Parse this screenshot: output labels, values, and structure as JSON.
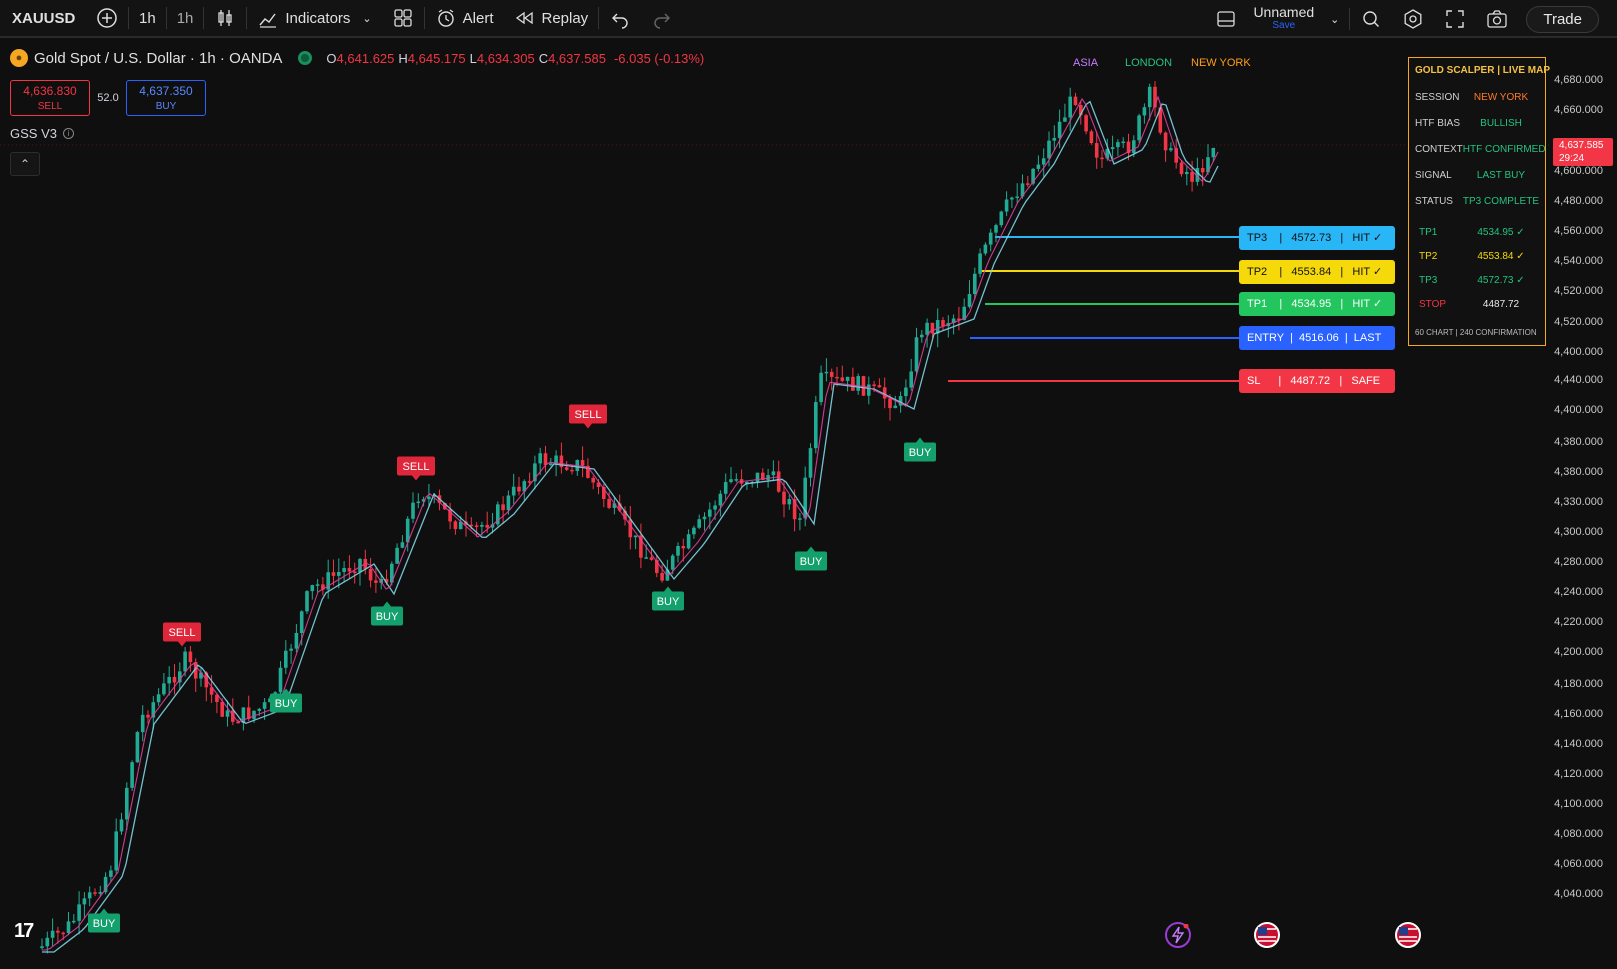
{
  "toolbar": {
    "symbol": "XAUUSD",
    "interval_1": "1h",
    "interval_2": "1h",
    "indicators_label": "Indicators",
    "alert_label": "Alert",
    "replay_label": "Replay",
    "layout_name": "Unnamed",
    "save_label": "Save",
    "trade_label": "Trade"
  },
  "header": {
    "title": "Gold Spot / U.S. Dollar · 1h · OANDA",
    "open_label": "O",
    "open": "4,641.625",
    "high_label": "H",
    "high": "4,645.175",
    "low_label": "L",
    "low": "4,634.305",
    "close_label": "C",
    "close": "4,637.585",
    "change": "-6.035 (-0.13%)",
    "sell_price": "4,636.830",
    "sell_label": "SELL",
    "spread": "52.0",
    "buy_price": "4,637.350",
    "buy_label": "BUY",
    "indicator_name": "GSS V3"
  },
  "sessions": [
    {
      "label": "ASIA",
      "color": "#c77dff"
    },
    {
      "label": "LONDON",
      "color": "#26c281"
    },
    {
      "label": "NEW YORK",
      "color": "#ff9f1a"
    }
  ],
  "levels": {
    "tp3": {
      "text": "TP3    |   4572.73   |   HIT ✓",
      "color": "#29b6f6"
    },
    "tp2": {
      "text": "TP2    |   4553.84   |   HIT ✓",
      "color": "#f5d90a"
    },
    "tp1": {
      "text": "TP1    |   4534.95   |   HIT ✓",
      "color": "#22c55e"
    },
    "entry": {
      "text": "ENTRY  |  4516.06  |  LAST",
      "color": "#2962ff"
    },
    "sl": {
      "text": "SL      |   4487.72   |   SAFE",
      "color": "#f23645"
    }
  },
  "dashboard": {
    "title": "GOLD SCALPER | LIVE MAP",
    "rows": [
      {
        "key": "SESSION",
        "value": "NEW YORK",
        "color": "#ff7a29"
      },
      {
        "key": "HTF BIAS",
        "value": "BULLISH",
        "color": "#26c281"
      },
      {
        "key": "CONTEXT",
        "value": "HTF CONFIRMED",
        "color": "#26c281"
      },
      {
        "key": "SIGNAL",
        "value": "LAST BUY",
        "color": "#26c281"
      },
      {
        "key": "STATUS",
        "value": "TP3 COMPLETE",
        "color": "#26c281"
      }
    ],
    "tps": [
      {
        "key": "TP1",
        "value": "4534.95 ✓",
        "color": "#26c281"
      },
      {
        "key": "TP2",
        "value": "4553.84 ✓",
        "color": "#f5d90a"
      },
      {
        "key": "TP3",
        "value": "4572.73 ✓",
        "color": "#26c281"
      },
      {
        "key": "STOP",
        "value": "4487.72",
        "color": "#f23645"
      }
    ],
    "footer": "60 CHART | 240 CONFIRMATION"
  },
  "price_axis": [
    "4,680.000",
    "4,660.000",
    "4,600.000",
    "4,480.000",
    "4,560.000",
    "4,540.000",
    "4,520.000",
    "4,520.000",
    "4,400.000",
    "4,440.000",
    "4,400.000",
    "4,380.000",
    "4,380.000",
    "4,330.000",
    "4,300.000",
    "4,280.000",
    "4,240.000",
    "4,220.000",
    "4,200.000",
    "4,180.000",
    "4,160.000",
    "4,140.000",
    "4,120.000",
    "4,100.000",
    "4,080.000",
    "4,060.000",
    "4,040.000"
  ],
  "current_price": "4,637.585",
  "countdown": "29:24",
  "signals": [
    {
      "label": "BUY",
      "type": "buy"
    },
    {
      "label": "SELL",
      "type": "sell"
    },
    {
      "label": "BUY",
      "type": "buy"
    },
    {
      "label": "BUY",
      "type": "buy"
    },
    {
      "label": "SELL",
      "type": "sell"
    },
    {
      "label": "SELL",
      "type": "sell"
    },
    {
      "label": "BUY",
      "type": "buy"
    },
    {
      "label": "BUY",
      "type": "buy"
    },
    {
      "label": "BUY",
      "type": "buy"
    }
  ],
  "colors": {
    "up": "#22ab94",
    "down": "#f23645",
    "ma_fast": "#e040a0",
    "ma_slow": "#7fd4e8"
  },
  "logo": "17"
}
